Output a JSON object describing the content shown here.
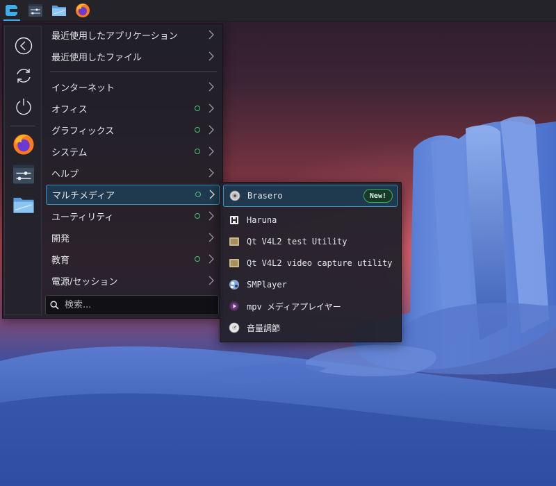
{
  "taskbar": {
    "launchers": [
      {
        "icon": "application-launcher-icon",
        "active": true
      },
      {
        "icon": "system-settings-icon",
        "active": false
      },
      {
        "icon": "file-manager-icon",
        "active": false
      },
      {
        "icon": "firefox-icon",
        "active": false
      }
    ]
  },
  "menu": {
    "quick_actions": [
      {
        "icon": "back-arrow-icon"
      },
      {
        "icon": "refresh-icon"
      },
      {
        "icon": "power-icon"
      }
    ],
    "favorites": [
      {
        "icon": "firefox-icon"
      },
      {
        "icon": "system-settings-icon"
      },
      {
        "icon": "file-manager-icon"
      }
    ],
    "recent": [
      {
        "label": "最近使用したアプリケーション"
      },
      {
        "label": "最近使用したファイル"
      }
    ],
    "categories": [
      {
        "label": "インターネット",
        "new_indicator": false
      },
      {
        "label": "オフィス",
        "new_indicator": true
      },
      {
        "label": "グラフィックス",
        "new_indicator": true
      },
      {
        "label": "システム",
        "new_indicator": true
      },
      {
        "label": "ヘルプ",
        "new_indicator": false
      },
      {
        "label": "マルチメディア",
        "new_indicator": true,
        "selected": true
      },
      {
        "label": "ユーティリティ",
        "new_indicator": true
      },
      {
        "label": "開発",
        "new_indicator": false
      },
      {
        "label": "教育",
        "new_indicator": true
      },
      {
        "label": "電源/セッション",
        "new_indicator": false
      }
    ],
    "search": {
      "placeholder": "検索..."
    }
  },
  "submenu": {
    "items": [
      {
        "label": "Brasero",
        "icon": "disc-burner-icon",
        "badge": "New!",
        "selected": true
      },
      {
        "label": "Haruna",
        "icon": "haruna-icon"
      },
      {
        "label": "Qt V4L2 test Utility",
        "icon": "video-device-icon"
      },
      {
        "label": "Qt V4L2 video capture utility",
        "icon": "video-device-icon"
      },
      {
        "label": "SMPlayer",
        "icon": "smplayer-icon"
      },
      {
        "label": "mpv メディアプレイヤー",
        "icon": "mpv-icon"
      },
      {
        "label": "音量調節",
        "icon": "volume-control-icon"
      }
    ]
  },
  "colors": {
    "accent": "#3daee9",
    "selection_bg": "#1f3a4e",
    "new_indicator": "#48c774",
    "panel_bg": "#25232a"
  }
}
